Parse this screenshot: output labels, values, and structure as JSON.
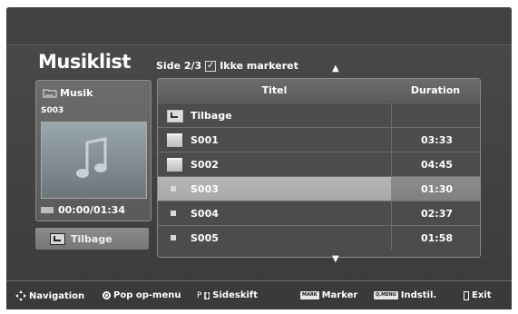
{
  "header": {
    "title": "Musiklist",
    "page_info": "Side 2/3",
    "checkbox_label": "Ikke markeret"
  },
  "left_panel": {
    "folder_label": "Musik",
    "current_file": "S003",
    "time": "00:00/01:34",
    "back_button": "Tilbage"
  },
  "table": {
    "col_title": "Titel",
    "col_duration": "Duration",
    "rows": [
      {
        "type": "back",
        "name": "Tilbage",
        "duration": ""
      },
      {
        "type": "folder",
        "name": "S001",
        "duration": "03:33"
      },
      {
        "type": "folder",
        "name": "S002",
        "duration": "04:45"
      },
      {
        "type": "file",
        "name": "S003",
        "duration": "01:30",
        "selected": true
      },
      {
        "type": "file",
        "name": "S004",
        "duration": "02:37"
      },
      {
        "type": "file",
        "name": "S005",
        "duration": "01:58"
      }
    ]
  },
  "bottom_bar": {
    "navigation": "Navigation",
    "popup": "Pop op-menu",
    "page_prefix": "P",
    "page_switch": "Sideskift",
    "mark_key": "MARK",
    "mark": "Marker",
    "menu_key": "Q.MENU",
    "settings": "Indstil.",
    "exit": "Exit"
  },
  "colors": {
    "background": "#444444",
    "selected_row": "#b0b0b0",
    "text": "#ffffff"
  }
}
